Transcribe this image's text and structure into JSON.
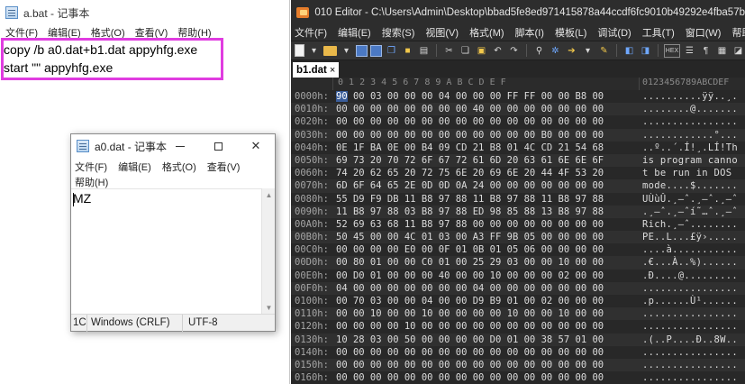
{
  "notepad_main": {
    "title": "a.bat - 记事本",
    "menu": [
      "文件(F)",
      "编辑(E)",
      "格式(O)",
      "查看(V)",
      "帮助(H)"
    ],
    "lines": [
      "copy /b a0.dat+b1.dat appyhfg.exe",
      "start \"\" appyhfg.exe"
    ],
    "highlight_color": "#e03ce0"
  },
  "editor": {
    "title": "010 Editor - C:\\Users\\Admin\\Desktop\\bbad5fe8ed971415878a44ccdf6fc9010b49292e4fba57b",
    "menu": [
      "文件(F)",
      "编辑(E)",
      "搜索(S)",
      "视图(V)",
      "格式(M)",
      "脚本(I)",
      "模板(L)",
      "调试(D)",
      "工具(T)",
      "窗口(W)",
      "帮助(H)"
    ],
    "tab_label": "b1.dat",
    "tab_close": "×",
    "hex_header": "0  1  2  3  4  5  6  7  8  9  A  B  C  D  E  F",
    "ascii_header": "0123456789ABCDEF",
    "rows": [
      {
        "offset": "0000h:",
        "hex": "90 00 03 00 00 00 04 00 00 00 FF FF 00 00 B8 00",
        "ascii": "..........ÿÿ..¸."
      },
      {
        "offset": "0010h:",
        "hex": "00 00 00 00 00 00 00 00 40 00 00 00 00 00 00 00",
        "ascii": "........@......."
      },
      {
        "offset": "0020h:",
        "hex": "00 00 00 00 00 00 00 00 00 00 00 00 00 00 00 00",
        "ascii": "................"
      },
      {
        "offset": "0030h:",
        "hex": "00 00 00 00 00 00 00 00 00 00 00 00 B0 00 00 00",
        "ascii": "............°..."
      },
      {
        "offset": "0040h:",
        "hex": "0E 1F BA 0E 00 B4 09 CD 21 B8 01 4C CD 21 54 68",
        "ascii": "..º..´.Í!¸.LÍ!Th"
      },
      {
        "offset": "0050h:",
        "hex": "69 73 20 70 72 6F 67 72 61 6D 20 63 61 6E 6E 6F",
        "ascii": "is program canno"
      },
      {
        "offset": "0060h:",
        "hex": "74 20 62 65 20 72 75 6E 20 69 6E 20 44 4F 53 20",
        "ascii": "t be run in DOS "
      },
      {
        "offset": "0070h:",
        "hex": "6D 6F 64 65 2E 0D 0D 0A 24 00 00 00 00 00 00 00",
        "ascii": "mode....$......."
      },
      {
        "offset": "0080h:",
        "hex": "55 D9 F9 DB 11 B8 97 88 11 B8 97 88 11 B8 97 88",
        "ascii": "UÙùÛ.¸—ˆ.¸—ˆ.¸—ˆ"
      },
      {
        "offset": "0090h:",
        "hex": "11 B8 97 88 03 B8 97 88 ED 98 85 88 13 B8 97 88",
        "ascii": ".¸—ˆ.¸—ˆí˜…ˆ.¸—ˆ"
      },
      {
        "offset": "00A0h:",
        "hex": "52 69 63 68 11 B8 97 88 00 00 00 00 00 00 00 00",
        "ascii": "Rich.¸—ˆ........"
      },
      {
        "offset": "00B0h:",
        "hex": "50 45 00 00 4C 01 03 00 A3 FF 9B 05 00 00 00 00",
        "ascii": "PE..L...£ÿ›....."
      },
      {
        "offset": "00C0h:",
        "hex": "00 00 00 00 E0 00 0F 01 0B 01 05 06 00 00 00 00",
        "ascii": "....à..........."
      },
      {
        "offset": "00D0h:",
        "hex": "00 80 01 00 00 C0 01 00 25 29 03 00 00 10 00 00",
        "ascii": ".€...À..%)......"
      },
      {
        "offset": "00E0h:",
        "hex": "00 D0 01 00 00 00 40 00 00 10 00 00 00 02 00 00",
        "ascii": ".Ð....@........."
      },
      {
        "offset": "00F0h:",
        "hex": "04 00 00 00 00 00 00 00 04 00 00 00 00 00 00 00",
        "ascii": "................"
      },
      {
        "offset": "0100h:",
        "hex": "00 70 03 00 00 04 00 00 D9 B9 01 00 02 00 00 00",
        "ascii": ".p......Ù¹......"
      },
      {
        "offset": "0110h:",
        "hex": "00 00 10 00 00 10 00 00 00 00 10 00 00 10 00 00",
        "ascii": "................"
      },
      {
        "offset": "0120h:",
        "hex": "00 00 00 00 10 00 00 00 00 00 00 00 00 00 00 00",
        "ascii": "................"
      },
      {
        "offset": "0130h:",
        "hex": "10 28 03 00 50 00 00 00 00 D0 01 00 38 57 01 00",
        "ascii": ".(..P....Ð..8W.."
      },
      {
        "offset": "0140h:",
        "hex": "00 00 00 00 00 00 00 00 00 00 00 00 00 00 00 00",
        "ascii": "................"
      },
      {
        "offset": "0150h:",
        "hex": "00 00 00 00 00 00 00 00 00 00 00 00 00 00 00 00",
        "ascii": "................"
      },
      {
        "offset": "0160h:",
        "hex": "00 00 00 00 00 00 00 00 00 00 00 00 00 00 00 00",
        "ascii": "................"
      }
    ]
  },
  "notepad_popup": {
    "title": "a0.dat - 记事本",
    "menu_line1": [
      "文件(F)",
      "编辑(E)",
      "格式(O)",
      "查看(V)"
    ],
    "menu_line2": [
      "帮助(H)"
    ],
    "content": "MZ",
    "status_pos": "1C",
    "status_eol": "Windows (CRLF)",
    "status_enc": "UTF-8"
  }
}
